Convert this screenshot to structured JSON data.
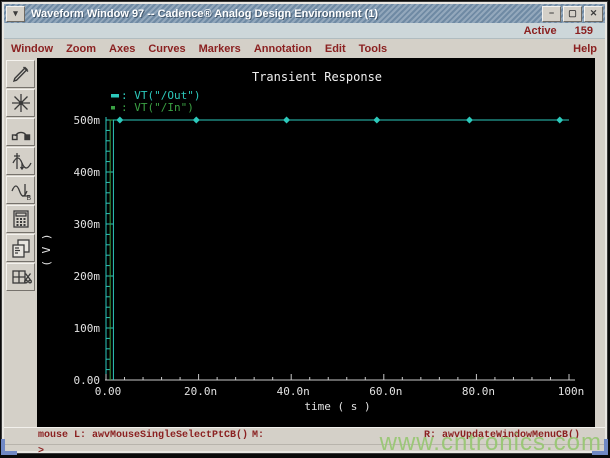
{
  "window": {
    "title": "Waveform Window 97 -- Cadence® Analog Design Environment (1)",
    "controls": {
      "minimize": "−",
      "maximize": "▢",
      "close": "✕",
      "menu_glyph": "▾"
    }
  },
  "active_row": {
    "label": "Active",
    "value": "159"
  },
  "menu": {
    "items": [
      "Window",
      "Zoom",
      "Axes",
      "Curves",
      "Markers",
      "Annotation",
      "Edit",
      "Tools"
    ],
    "help": "Help"
  },
  "toolbar": {
    "icons": [
      "pen-icon",
      "zoom-fit-icon",
      "probe-icon",
      "sweep-wave-icon",
      "calc-wave-icon",
      "calculator-icon",
      "copy-window-icon",
      "split-window-icon"
    ]
  },
  "status": {
    "mouse_left": "mouse L: awvMouseSingleSelectPtCB()",
    "mouse_middle": "M:",
    "mouse_right": "R: awvUpdateWindowMenuCB()",
    "prompt": ">"
  },
  "watermark": "www.cntronics.com",
  "chart_data": {
    "type": "line",
    "title": "Transient Response",
    "xlabel": "time ( s )",
    "ylabel": "( V )",
    "xlim_ns": [
      0,
      100
    ],
    "ylim_mV": [
      0,
      500
    ],
    "x_ticks": [
      {
        "t": 0,
        "label": "0.00"
      },
      {
        "t": 20,
        "label": "20.0n"
      },
      {
        "t": 40,
        "label": "40.0n"
      },
      {
        "t": 60,
        "label": "60.0n"
      },
      {
        "t": 80,
        "label": "80.0n"
      },
      {
        "t": 100,
        "label": "100n"
      }
    ],
    "y_ticks": [
      {
        "v": 0,
        "label": "0.00"
      },
      {
        "v": 100,
        "label": "100m"
      },
      {
        "v": 200,
        "label": "200m"
      },
      {
        "v": 300,
        "label": "300m"
      },
      {
        "v": 400,
        "label": "400m"
      },
      {
        "v": 500,
        "label": "500m"
      }
    ],
    "x_minor_step_ns": 4,
    "y_minor_step_mV": 20,
    "grid": false,
    "legend_position": "top-left",
    "axis_colors": {
      "y_axis": "#2cc9bb",
      "x_axis": "#c8c8c8",
      "labels": "#e2e2e2",
      "title": "#f0f0f0"
    },
    "series": [
      {
        "name": "VT(\"/Out\")",
        "color": "#2cc9bb",
        "marker": "diamond",
        "marker_t_ns": [
          3,
          19.5,
          39,
          58.5,
          78.5,
          98
        ],
        "points": [
          [
            1.6,
            0
          ],
          [
            1.6,
            500
          ],
          [
            100,
            500
          ]
        ]
      },
      {
        "name": "VT(\"/In\")",
        "color": "#3aa043",
        "marker": "none",
        "points": [
          [
            0.9,
            0
          ],
          [
            0.9,
            500
          ],
          [
            100,
            500
          ]
        ]
      }
    ]
  }
}
